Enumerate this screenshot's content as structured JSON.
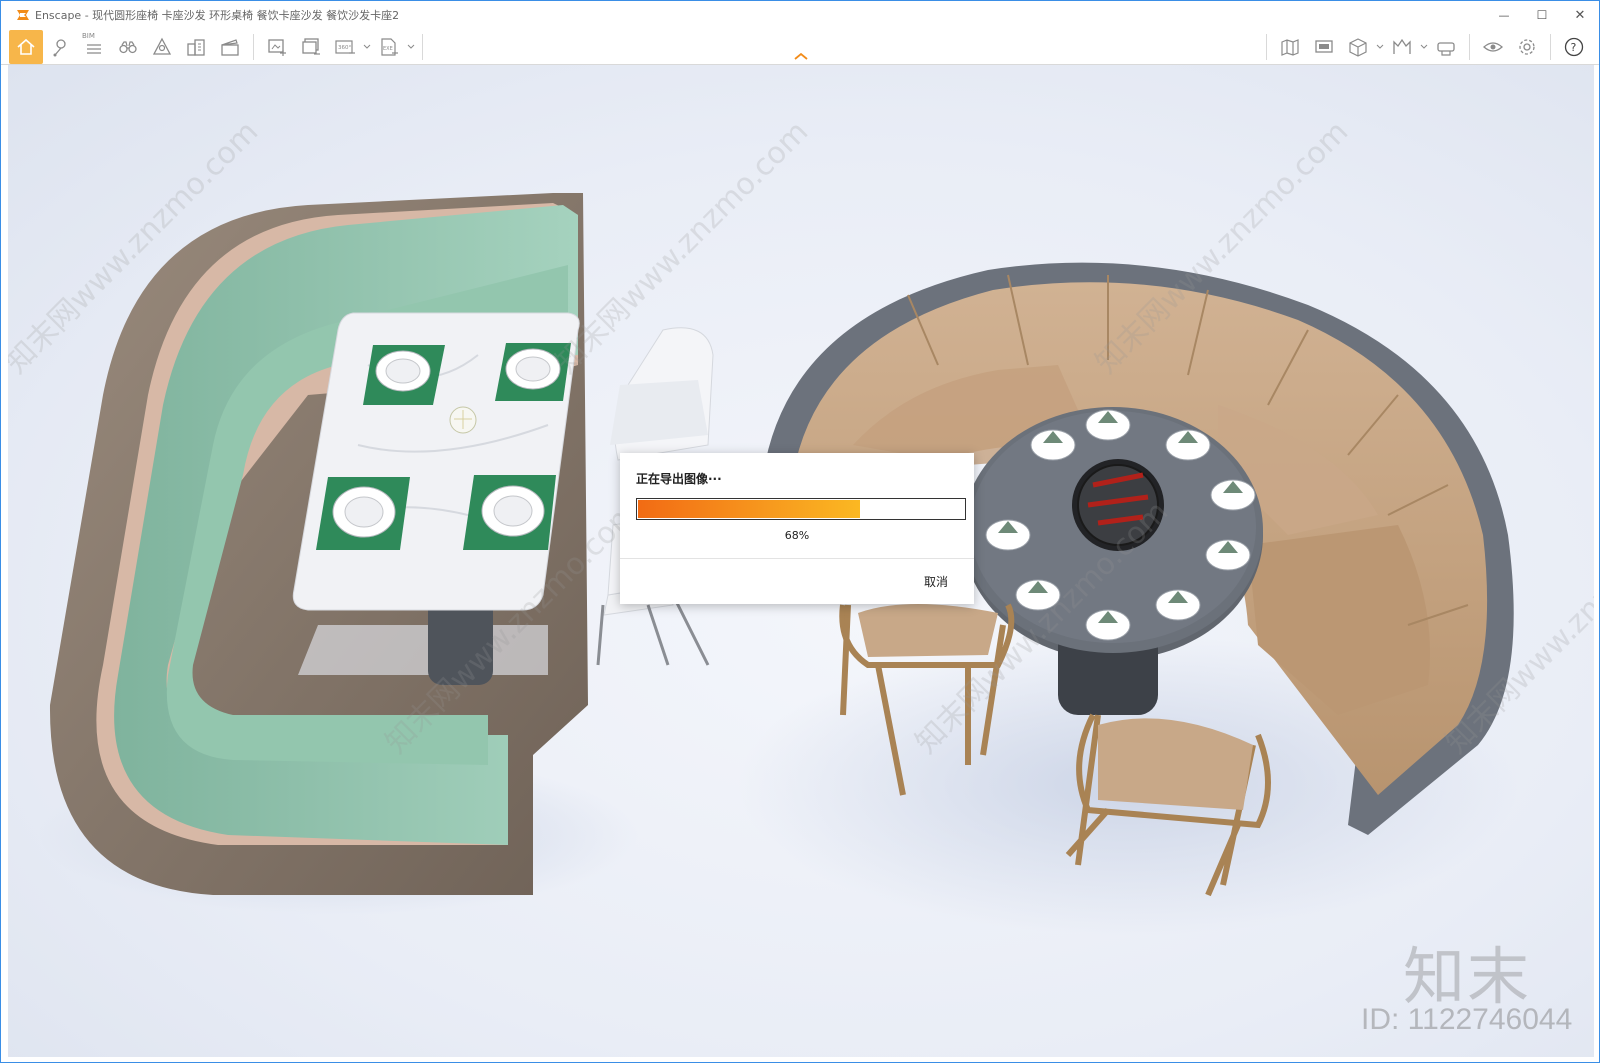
{
  "window": {
    "app_name": "Enscape",
    "title": "Enscape - 现代圆形座椅 卡座沙发 环形桌椅 餐饮卡座沙发 餐饮沙发卡座2",
    "controls": {
      "minimize": "—",
      "maximize": "☐",
      "close": "✕"
    }
  },
  "toolbar": {
    "bim_label": "BIM",
    "video_badge": "360°",
    "exe_badge": "EXE",
    "help_label": "?"
  },
  "dialog": {
    "title": "正在导出图像···",
    "progress": 0.68,
    "progress_text": "68%",
    "cancel_label": "取消"
  },
  "watermark": {
    "logo": "知末",
    "id": "ID: 1122746044",
    "tile": "知末网www.znzmo.com"
  },
  "colors": {
    "accent": "#f7b64a",
    "progress_start": "#f26b14",
    "progress_end": "#fbb822",
    "sofa_green": "#8fc4ad",
    "sofa_tan": "#c6a584",
    "frame_grey": "#6c727c",
    "wood": "#8a7a6c"
  }
}
